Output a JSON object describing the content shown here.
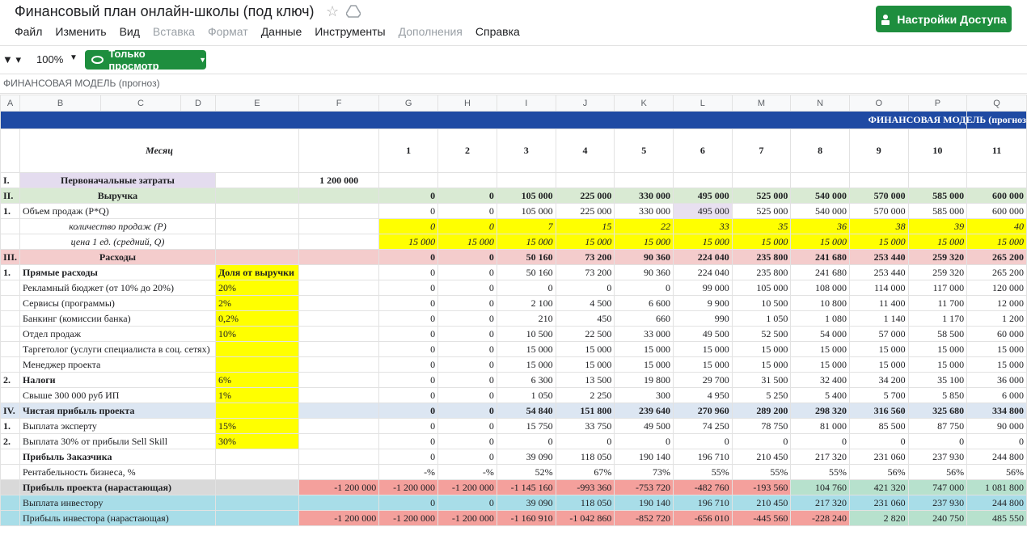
{
  "header": {
    "title": "Финансовый план онлайн-школы (под ключ)",
    "menu": [
      "Файл",
      "Изменить",
      "Вид",
      "Вставка",
      "Формат",
      "Данные",
      "Инструменты",
      "Дополнения",
      "Справка"
    ],
    "menu_disabled": [
      false,
      false,
      false,
      true,
      true,
      false,
      false,
      true,
      false
    ],
    "share_label": "Настройки Доступа"
  },
  "toolbar": {
    "zoom": "100%",
    "view_only_label": "Только просмотр"
  },
  "formula_bar": {
    "text": "ФИНАНСОВАЯ МОДЕЛЬ (прогноз)"
  },
  "columns": [
    "A",
    "B",
    "C",
    "D",
    "E",
    "F",
    "G",
    "H",
    "I",
    "J",
    "K",
    "L",
    "M",
    "N",
    "O",
    "P",
    "Q"
  ],
  "banner_text": "ФИНАНСОВАЯ МОДЕЛЬ (прогноз",
  "month_label": "Месяц",
  "months": [
    "1",
    "2",
    "3",
    "4",
    "5",
    "6",
    "7",
    "8",
    "9",
    "10",
    "11"
  ],
  "rows": [
    {
      "a": "I.",
      "label": "Первоначальные затраты",
      "lstyle": "pur b ctr",
      "e": "",
      "f": "1 200 000",
      "fstyle": "b ctr",
      "vals": [
        "",
        "",
        "",
        "",
        "",
        "",
        "",
        "",
        "",
        "",
        ""
      ],
      "vstyle": ""
    },
    {
      "a": "II.",
      "label": "Выручка",
      "lstyle": "grn b ctr",
      "astyle": "grn",
      "e": "",
      "estyle": "grn",
      "f": "",
      "fstyle": "grn",
      "vals": [
        "0",
        "0",
        "105 000",
        "225 000",
        "330 000",
        "495 000",
        "525 000",
        "540 000",
        "570 000",
        "585 000",
        "600 000"
      ],
      "vstyle": "grn b"
    },
    {
      "a": "1.",
      "label": "Объем продаж (P*Q)",
      "lstyle": "",
      "e": "",
      "f": "",
      "vals": [
        "0",
        "0",
        "105 000",
        "225 000",
        "330 000",
        "495 000",
        "525 000",
        "540 000",
        "570 000",
        "585 000",
        "600 000"
      ],
      "vstyle": ""
    },
    {
      "a": "",
      "label": "количество продаж (P)",
      "lstyle": "i ctr",
      "e": "",
      "f": "",
      "vals": [
        "0",
        "0",
        "7",
        "15",
        "22",
        "33",
        "35",
        "36",
        "38",
        "39",
        "40"
      ],
      "vstyle": "yel i"
    },
    {
      "a": "",
      "label": "цена 1 ед. (средний, Q)",
      "lstyle": "i ctr",
      "e": "",
      "f": "",
      "vals": [
        "15 000",
        "15 000",
        "15 000",
        "15 000",
        "15 000",
        "15 000",
        "15 000",
        "15 000",
        "15 000",
        "15 000",
        "15 000"
      ],
      "vstyle": "yel i"
    },
    {
      "a": "III.",
      "label": "Расходы",
      "lstyle": "red b ctr",
      "astyle": "red",
      "e": "",
      "estyle": "red",
      "f": "",
      "fstyle": "red",
      "vals": [
        "0",
        "0",
        "50 160",
        "73 200",
        "90 360",
        "224 040",
        "235 800",
        "241 680",
        "253 440",
        "259 320",
        "265 200"
      ],
      "vstyle": "red b"
    },
    {
      "a": "1.",
      "label": "Прямые расходы",
      "lstyle": "b",
      "e": "Доля от выручки",
      "estyle": "yel b",
      "f": "",
      "vals": [
        "0",
        "0",
        "50 160",
        "73 200",
        "90 360",
        "224 040",
        "235 800",
        "241 680",
        "253 440",
        "259 320",
        "265 200"
      ],
      "vstyle": ""
    },
    {
      "a": "",
      "label": "Рекламный бюджет (от 10% до 20%)",
      "lstyle": "",
      "e": "20%",
      "estyle": "yel",
      "f": "",
      "vals": [
        "0",
        "0",
        "0",
        "0",
        "0",
        "99 000",
        "105 000",
        "108 000",
        "114 000",
        "117 000",
        "120 000"
      ],
      "vstyle": ""
    },
    {
      "a": "",
      "label": "Сервисы (программы)",
      "lstyle": "",
      "e": "2%",
      "estyle": "yel",
      "f": "",
      "vals": [
        "0",
        "0",
        "2 100",
        "4 500",
        "6 600",
        "9 900",
        "10 500",
        "10 800",
        "11 400",
        "11 700",
        "12 000"
      ],
      "vstyle": ""
    },
    {
      "a": "",
      "label": "Банкинг (комиссии банка)",
      "lstyle": "",
      "e": "0,2%",
      "estyle": "yel",
      "f": "",
      "vals": [
        "0",
        "0",
        "210",
        "450",
        "660",
        "990",
        "1 050",
        "1 080",
        "1 140",
        "1 170",
        "1 200"
      ],
      "vstyle": ""
    },
    {
      "a": "",
      "label": "Отдел продаж",
      "lstyle": "",
      "e": "10%",
      "estyle": "yel",
      "f": "",
      "vals": [
        "0",
        "0",
        "10 500",
        "22 500",
        "33 000",
        "49 500",
        "52 500",
        "54 000",
        "57 000",
        "58 500",
        "60 000"
      ],
      "vstyle": ""
    },
    {
      "a": "",
      "label": "Таргетолог (услуги специалиста в соц. сетях)",
      "lstyle": "",
      "e": "",
      "estyle": "yel",
      "f": "",
      "vals": [
        "0",
        "0",
        "15 000",
        "15 000",
        "15 000",
        "15 000",
        "15 000",
        "15 000",
        "15 000",
        "15 000",
        "15 000"
      ],
      "vstyle": ""
    },
    {
      "a": "",
      "label": "Менеджер проекта",
      "lstyle": "",
      "e": "",
      "estyle": "yel",
      "f": "",
      "vals": [
        "0",
        "0",
        "15 000",
        "15 000",
        "15 000",
        "15 000",
        "15 000",
        "15 000",
        "15 000",
        "15 000",
        "15 000"
      ],
      "vstyle": ""
    },
    {
      "a": "2.",
      "label": "Налоги",
      "lstyle": "b",
      "e": "6%",
      "estyle": "yel",
      "f": "",
      "vals": [
        "0",
        "0",
        "6 300",
        "13 500",
        "19 800",
        "29 700",
        "31 500",
        "32 400",
        "34 200",
        "35 100",
        "36 000"
      ],
      "vstyle": ""
    },
    {
      "a": "",
      "label": "Свыше 300 000 руб ИП",
      "lstyle": "",
      "e": "1%",
      "estyle": "yel",
      "f": "",
      "vals": [
        "0",
        "0",
        "1 050",
        "2 250",
        "300",
        "4 950",
        "5 250",
        "5 400",
        "5 700",
        "5 850",
        "6 000"
      ],
      "vstyle": ""
    },
    {
      "a": "IV.",
      "label": "Чистая прибыль проекта",
      "lstyle": "blu b",
      "astyle": "blu",
      "e": "",
      "estyle": "yel",
      "f": "",
      "fstyle": "blu",
      "vals": [
        "0",
        "0",
        "54 840",
        "151 800",
        "239 640",
        "270 960",
        "289 200",
        "298 320",
        "316 560",
        "325 680",
        "334 800"
      ],
      "vstyle": "blu b"
    },
    {
      "a": "1.",
      "label": "Выплата эксперту",
      "lstyle": "",
      "e": "15%",
      "estyle": "yel",
      "f": "",
      "vals": [
        "0",
        "0",
        "15 750",
        "33 750",
        "49 500",
        "74 250",
        "78 750",
        "81 000",
        "85 500",
        "87 750",
        "90 000"
      ],
      "vstyle": ""
    },
    {
      "a": "2.",
      "label": "Выплата 30% от прибыли Sell Skill",
      "lstyle": "",
      "e": "30%",
      "estyle": "yel",
      "f": "",
      "vals": [
        "0",
        "0",
        "0",
        "0",
        "0",
        "0",
        "0",
        "0",
        "0",
        "0",
        "0"
      ],
      "vstyle": ""
    },
    {
      "a": "",
      "label": "Прибыль Заказчика",
      "lstyle": "b",
      "e": "",
      "f": "",
      "vals": [
        "0",
        "0",
        "39 090",
        "118 050",
        "190 140",
        "196 710",
        "210 450",
        "217 320",
        "231 060",
        "237 930",
        "244 800"
      ],
      "vstyle": ""
    },
    {
      "a": "",
      "label": "Рентабельность бизнеса, %",
      "lstyle": "",
      "e": "",
      "f": "",
      "vals": [
        "-%",
        "-%",
        "52%",
        "67%",
        "73%",
        "55%",
        "55%",
        "55%",
        "56%",
        "56%",
        "56%"
      ],
      "vstyle": ""
    },
    {
      "a": "",
      "label": "Прибыль проекта (нарастающая)",
      "lstyle": "gry b",
      "astyle": "gry",
      "e": "",
      "estyle": "gry",
      "f": "-1 200 000",
      "fstyle": "sal",
      "vals": [
        "-1 200 000",
        "-1 200 000",
        "-1 145 160",
        "-993 360",
        "-753 720",
        "-482 760",
        "-193 560",
        "104 760",
        "421 320",
        "747 000",
        "1 081 800"
      ],
      "vstyle": "sal",
      "vstyle_pos": "mint"
    },
    {
      "a": "",
      "label": "Выплата инвестору",
      "lstyle": "cyan",
      "astyle": "cyan",
      "e": "",
      "estyle": "cyan",
      "f": "",
      "fstyle": "cyan",
      "vals": [
        "0",
        "0",
        "39 090",
        "118 050",
        "190 140",
        "196 710",
        "210 450",
        "217 320",
        "231 060",
        "237 930",
        "244 800"
      ],
      "vstyle": "cyan"
    },
    {
      "a": "",
      "label": "Прибыль инвестора (нарастающая)",
      "lstyle": "cyan",
      "astyle": "cyan",
      "e": "",
      "estyle": "cyan",
      "f": "-1 200 000",
      "fstyle": "sal",
      "vals": [
        "-1 200 000",
        "-1 200 000",
        "-1 160 910",
        "-1 042 860",
        "-852 720",
        "-656 010",
        "-445 560",
        "-228 240",
        "2 820",
        "240 750",
        "485 550"
      ],
      "vstyle": "sal",
      "vstyle_pos": "mint"
    }
  ]
}
